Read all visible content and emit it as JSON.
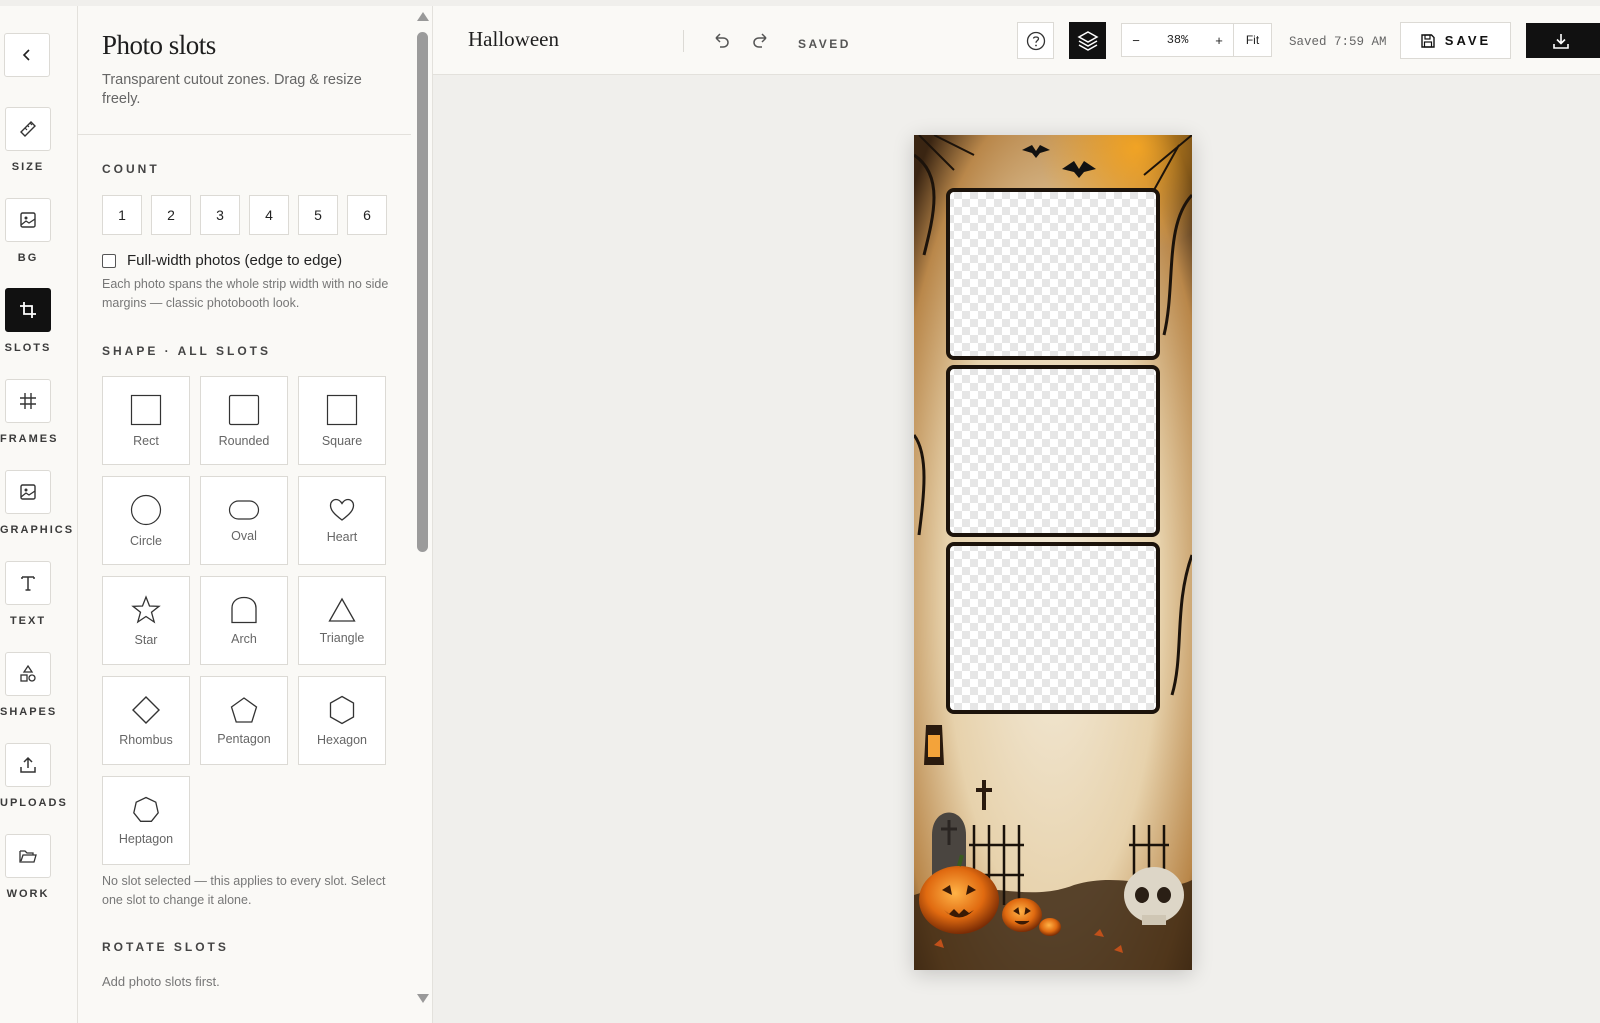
{
  "rail": {
    "back_icon": "chevron-left-icon",
    "items": [
      {
        "label": "SIZE",
        "icon": "ruler-icon"
      },
      {
        "label": "BG",
        "icon": "image-icon"
      },
      {
        "label": "SLOTS",
        "icon": "crop-icon"
      },
      {
        "label": "FRAMES",
        "icon": "hash-icon"
      },
      {
        "label": "GRAPHICS",
        "icon": "image-icon"
      },
      {
        "label": "TEXT",
        "icon": "text-icon"
      },
      {
        "label": "SHAPES",
        "icon": "shapes-icon"
      },
      {
        "label": "UPLOADS",
        "icon": "upload-icon"
      },
      {
        "label": "WORK",
        "icon": "folder-icon"
      }
    ],
    "active": "SLOTS"
  },
  "panel": {
    "title": "Photo slots",
    "subtitle": "Transparent cutout zones. Drag & resize freely.",
    "count_label": "COUNT",
    "count_options": [
      "1",
      "2",
      "3",
      "4",
      "5",
      "6"
    ],
    "full_width_label": "Full-width photos (edge to edge)",
    "full_width_checked": false,
    "full_width_help": "Each photo spans the whole strip width with no side margins — classic photobooth look.",
    "shape_label": "SHAPE · ALL SLOTS",
    "shapes": [
      "Rect",
      "Rounded",
      "Square",
      "Circle",
      "Oval",
      "Heart",
      "Star",
      "Arch",
      "Triangle",
      "Rhombus",
      "Pentagon",
      "Hexagon",
      "Heptagon"
    ],
    "shape_help": "No slot selected — this applies to every slot. Select one slot to change it alone.",
    "rotate_label": "ROTATE SLOTS",
    "rotate_help": "Add photo slots first."
  },
  "topbar": {
    "title": "Halloween",
    "status": "SAVED",
    "zoom_minus": "−",
    "zoom_value": "38%",
    "zoom_plus": "+",
    "zoom_fit": "Fit",
    "saved_time": "Saved 7:59 AM",
    "save_label": "SAVE"
  },
  "colors": {
    "accent": "#111111",
    "panel_bg": "#faf9f6",
    "canvas_bg": "#f0efec",
    "border": "#dcdad5"
  }
}
